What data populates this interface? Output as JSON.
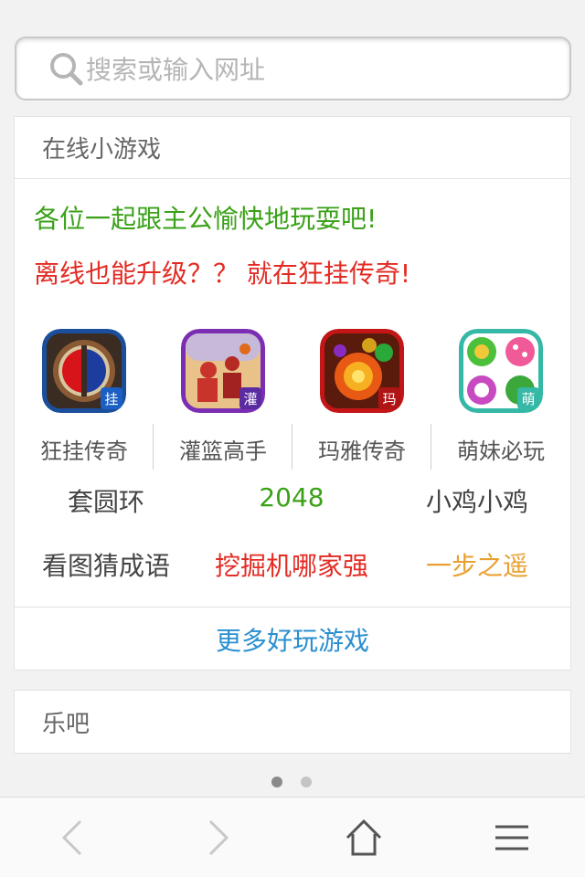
{
  "search": {
    "placeholder": "搜索或输入网址"
  },
  "games_card": {
    "title": "在线小游戏",
    "promo1": "各位一起跟主公愉快地玩耍吧!",
    "promo2": "离线也能升级？？ 就在狂挂传奇!",
    "apps": [
      {
        "label": "狂挂传奇",
        "badge": "挂",
        "icon": "game-kuanggua-icon"
      },
      {
        "label": "灌篮高手",
        "badge": "灌",
        "icon": "game-guanlan-icon"
      },
      {
        "label": "玛雅传奇",
        "badge": "玛",
        "icon": "game-maya-icon"
      },
      {
        "label": "萌妹必玩",
        "badge": "萌",
        "icon": "game-mengmei-icon"
      }
    ],
    "links_row1": [
      {
        "label": "套圆环",
        "color": "#444444"
      },
      {
        "label": "2048",
        "color": "#3aa118"
      },
      {
        "label": "小鸡小鸡",
        "color": "#444444"
      }
    ],
    "links_row2": [
      {
        "label": "看图猜成语",
        "color": "#444444"
      },
      {
        "label": "挖掘机哪家强",
        "color": "#e32b23"
      },
      {
        "label": "一步之遥",
        "color": "#e8a030"
      }
    ],
    "more": "更多好玩游戏"
  },
  "le_card": {
    "title": "乐吧"
  },
  "pager": {
    "count": 2,
    "active": 0
  },
  "bottom_nav": {
    "icons": [
      "back-arrow-icon",
      "forward-arrow-icon",
      "home-icon",
      "menu-icon"
    ]
  },
  "colors": {
    "green": "#3aa118",
    "red": "#e32b23",
    "blue": "#2a8fd0",
    "orange": "#e8a030"
  }
}
